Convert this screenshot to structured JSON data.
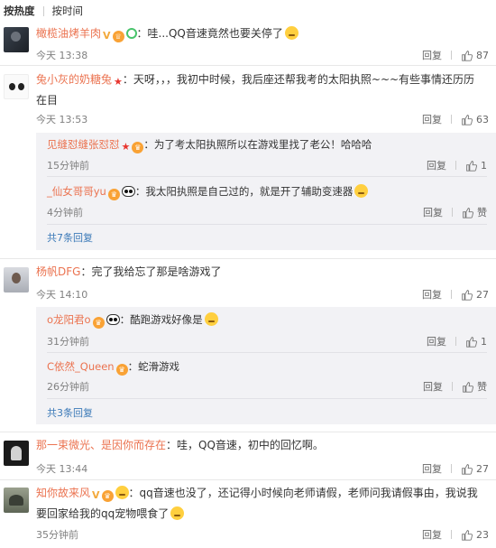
{
  "sort": {
    "hot": "按热度",
    "time": "按时间"
  },
  "actions": {
    "reply": "回复",
    "like_word": "赞"
  },
  "comments": [
    {
      "name": "橄榄油烤羊肉",
      "text": "：哇...QQ音速竟然也要关停了",
      "time": "今天 13:38",
      "likes": "87"
    },
    {
      "name": "兔小灰的奶糖兔",
      "text": "：天呀，，，我初中时候，我后座还帮我考的太阳执照~~~有些事情还历历在目",
      "time": "今天 13:53",
      "likes": "63",
      "replies": [
        {
          "name": "见缝怼缝张怼怼",
          "text": "：为了考太阳执照所以在游戏里找了老公！哈哈哈",
          "time": "15分钟前",
          "likes": "1"
        },
        {
          "name": "_仙女哥哥yu",
          "text": "：我太阳执照是自己过的，就是开了辅助变速器",
          "time": "4分钟前",
          "likes": ""
        }
      ],
      "more": "共7条回复"
    },
    {
      "name": "杨帆DFG",
      "text": "：完了我给忘了那是啥游戏了",
      "time": "今天 14:10",
      "likes": "27",
      "replies": [
        {
          "name": "o龙阳君o",
          "text": "：酷跑游戏好像是",
          "time": "31分钟前",
          "likes": "1"
        },
        {
          "name": "C依然_Queen",
          "text": "：蛇滑游戏",
          "time": "26分钟前",
          "likes": ""
        }
      ],
      "more": "共3条回复"
    },
    {
      "name": "那一束微光、是因你而存在",
      "text": "：哇，QQ音速，初中的回忆啊。",
      "time": "今天 13:44",
      "likes": "27"
    },
    {
      "name": "知你故来风",
      "text": "：qq音速也没了，还记得小时候向老师请假，老师问我请假事由，我说我要回家给我的qq宠物喂食了",
      "time": "35分钟前",
      "likes": "23"
    }
  ]
}
